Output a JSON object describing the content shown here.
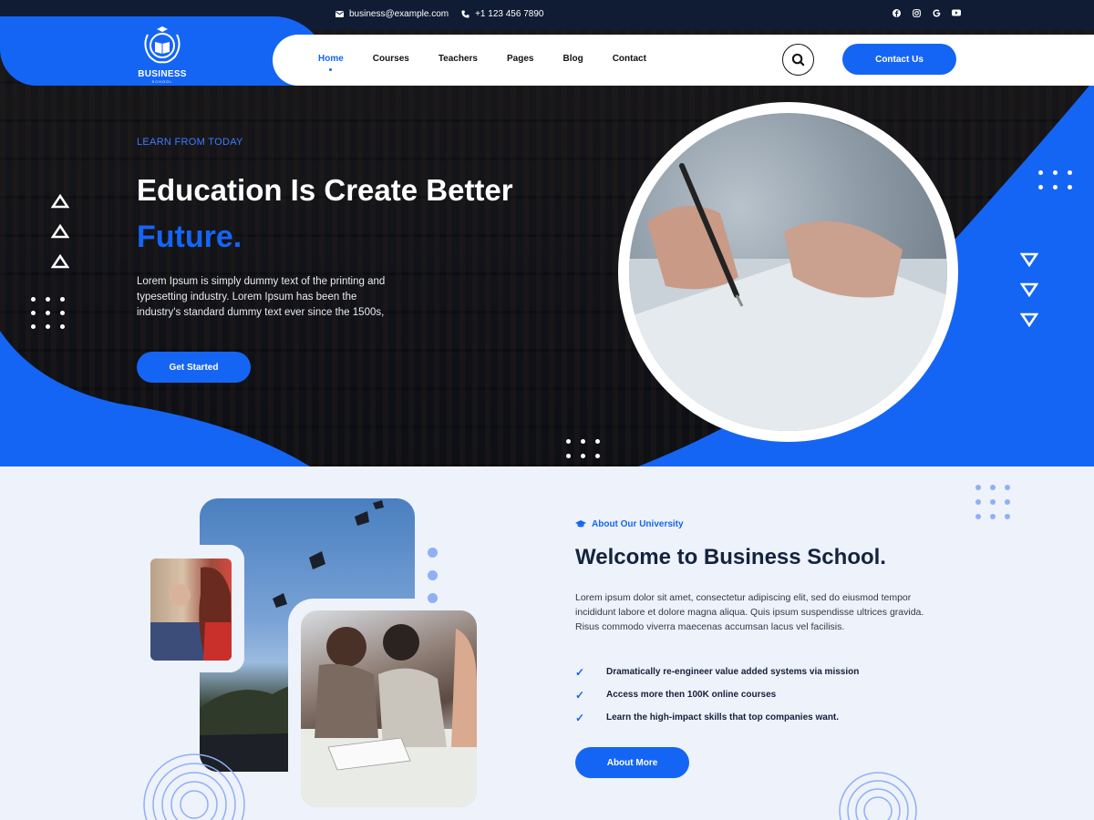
{
  "topbar": {
    "email": "business@example.com",
    "phone": "+1 123 456 7890",
    "socials": [
      "facebook-icon",
      "instagram-icon",
      "google-icon",
      "youtube-icon"
    ]
  },
  "brand": {
    "name": "BUSINESS",
    "tagline": "SCHOOL"
  },
  "nav": {
    "items": [
      "Home",
      "Courses",
      "Teachers",
      "Pages",
      "Blog",
      "Contact"
    ],
    "active": "Home",
    "cta": "Contact Us"
  },
  "hero": {
    "eyebrow": "LEARN FROM TODAY",
    "title_line1": "Education Is Create Better",
    "title_line2": "Future.",
    "description": "Lorem Ipsum is simply dummy text of the printing and typesetting industry. Lorem Ipsum has been the industry's standard dummy text ever since the 1500s,",
    "button": "Get Started"
  },
  "about": {
    "eyebrow": "About Our University",
    "title": "Welcome to Business School.",
    "description": "Lorem ipsum dolor sit amet, consectetur adipiscing elit, sed do eiusmod tempor incididunt labore et dolore magna aliqua. Quis ipsum suspendisse ultrices gravida. Risus commodo viverra maecenas accumsan lacus vel facilisis.",
    "features": [
      "Dramatically re-engineer value added systems via mission",
      "Access more then 100K online courses",
      "Learn the high-impact skills that top companies want."
    ],
    "button": "About More"
  },
  "colors": {
    "accent": "#1565f5",
    "dark": "#0f1c33",
    "light_bg": "#eef2fa"
  }
}
